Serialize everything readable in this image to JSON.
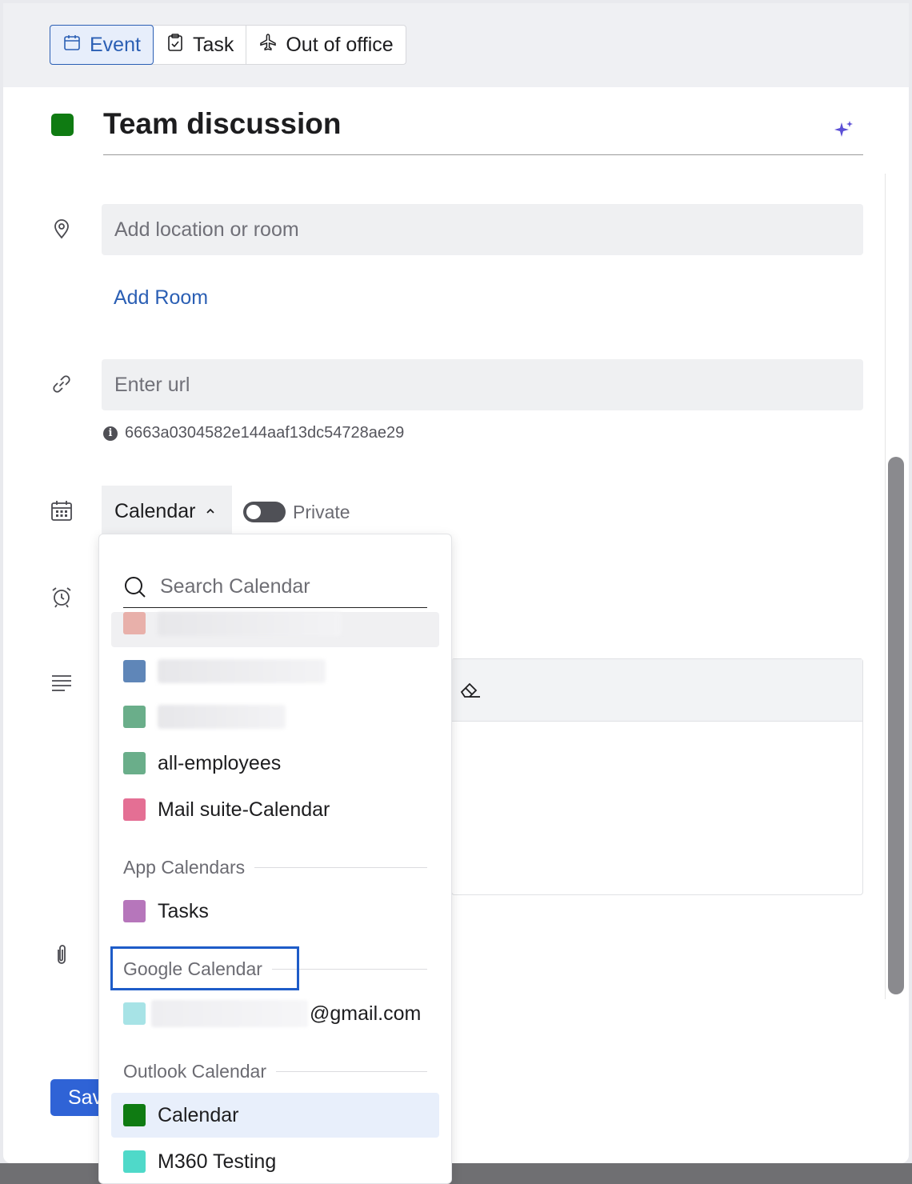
{
  "tabs": [
    {
      "label": "Event",
      "icon": "calendar-icon",
      "active": true
    },
    {
      "label": "Task",
      "icon": "clipboard-check-icon",
      "active": false
    },
    {
      "label": "Out of office",
      "icon": "airplane-icon",
      "active": false
    }
  ],
  "event": {
    "title": "Team discussion",
    "color": "#0f7b12"
  },
  "location": {
    "placeholder": "Add location or room",
    "add_room_label": "Add Room"
  },
  "url": {
    "placeholder": "Enter url",
    "meeting_id": "6663a0304582e144aaf13dc54728ae29"
  },
  "calendar": {
    "selected_label": "Calendar",
    "private_label": "Private",
    "private_on": false
  },
  "dropdown": {
    "search_placeholder": "Search Calendar",
    "my_calendars": [
      {
        "label": "",
        "color": "#e8b0aa",
        "blurred": true
      },
      {
        "label": "",
        "color": "#5f86b8",
        "blurred": true
      },
      {
        "label": "",
        "color": "#6aae8a",
        "blurred": true
      },
      {
        "label": "all-employees",
        "color": "#6aae8a"
      },
      {
        "label": "Mail suite-Calendar",
        "color": "#e46f94"
      }
    ],
    "app_calendars_heading": "App Calendars",
    "app_calendars": [
      {
        "label": "Tasks",
        "color": "#b676bb"
      }
    ],
    "google_heading": "Google Calendar",
    "google_calendars": [
      {
        "label": "@gmail.com",
        "color": "#a7e3e6"
      }
    ],
    "outlook_heading": "Outlook Calendar",
    "outlook_calendars": [
      {
        "label": "Calendar",
        "color": "#0f7b12",
        "selected": true
      },
      {
        "label": "M360 Testing",
        "color": "#4fd9c9"
      }
    ]
  },
  "save_label": "Save"
}
